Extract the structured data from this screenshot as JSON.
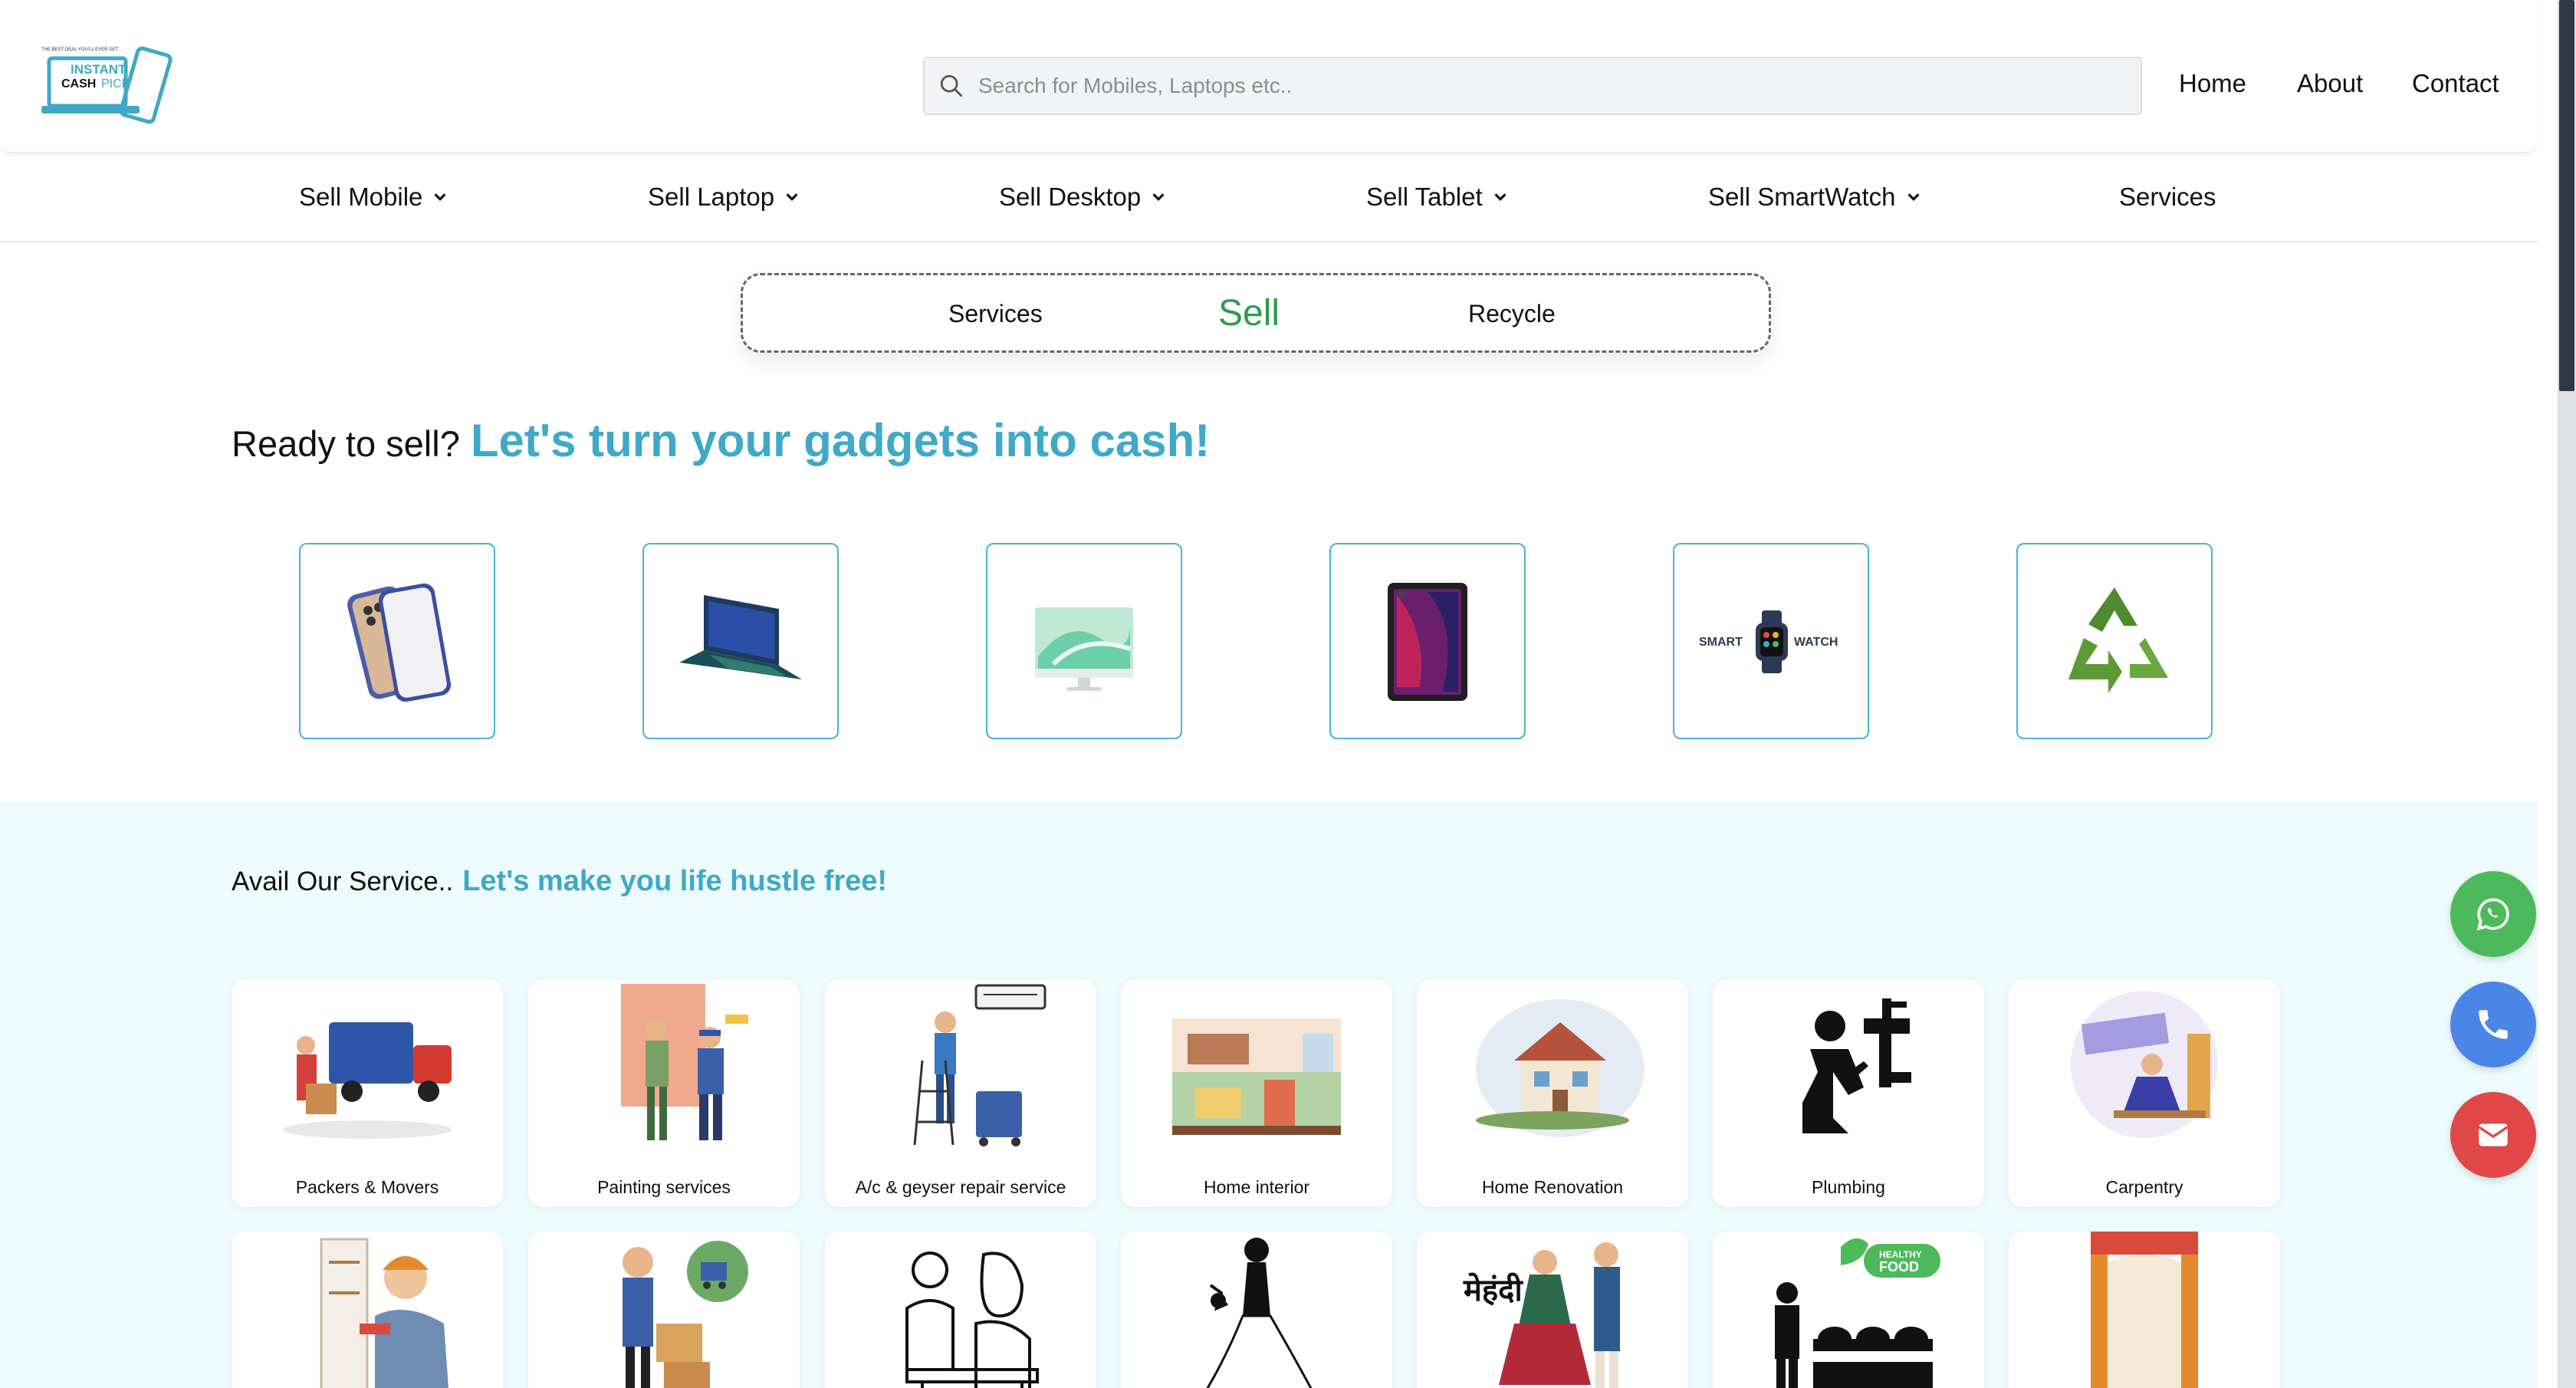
{
  "header": {
    "logo": {
      "tagline": "THE BEST DEAL YOU'LL EVER GET",
      "line1": "INSTANT",
      "line2": "CASH",
      "line3": "PICK"
    },
    "search": {
      "placeholder": "Search for Mobiles, Laptops etc.."
    },
    "nav": {
      "home": "Home",
      "about": "About",
      "contact": "Contact"
    }
  },
  "categories": [
    {
      "label": "Sell Mobile"
    },
    {
      "label": "Sell Laptop"
    },
    {
      "label": "Sell Desktop"
    },
    {
      "label": "Sell Tablet"
    },
    {
      "label": "Sell SmartWatch"
    },
    {
      "label": "Services"
    }
  ],
  "toggle": {
    "services": "Services",
    "sell": "Sell",
    "recycle": "Recycle",
    "active": "Sell"
  },
  "hero": {
    "prefix": "Ready to sell?",
    "highlight": "Let's turn your gadgets into cash!"
  },
  "devices": [
    {
      "icon": "mobile-phone-icon"
    },
    {
      "icon": "laptop-icon"
    },
    {
      "icon": "desktop-icon"
    },
    {
      "icon": "tablet-icon"
    },
    {
      "icon": "smartwatch-icon",
      "text_left": "SMART",
      "text_right": "WATCH"
    },
    {
      "icon": "recycle-icon"
    }
  ],
  "services_section": {
    "prefix": "Avail Our Service..",
    "highlight": "Let's make you life hustle free!",
    "row1": [
      {
        "label": "Packers & Movers"
      },
      {
        "label": "Painting services"
      },
      {
        "label": "A/c & geyser repair service"
      },
      {
        "label": "Home interior"
      },
      {
        "label": "Home Renovation"
      },
      {
        "label": "Plumbing"
      },
      {
        "label": "Carpentry"
      }
    ],
    "row2_badges": {
      "food_badge_1": "HEALTHY",
      "food_badge_2": "FOOD",
      "mehndi_text": "मेहंदी"
    }
  },
  "floating": [
    {
      "icon": "whatsapp-icon",
      "color": "#4cba5a"
    },
    {
      "icon": "phone-icon",
      "color": "#4a86e8"
    },
    {
      "icon": "email-icon",
      "color": "#e04848"
    }
  ],
  "colors": {
    "accent": "#3fa9c7",
    "sell_green": "#2e9b4a",
    "section_bg": "#eefbfc"
  }
}
